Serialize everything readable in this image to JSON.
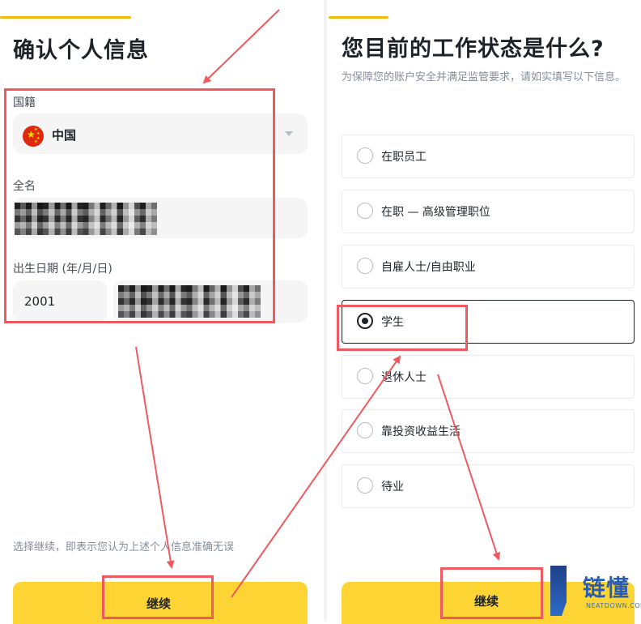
{
  "colors": {
    "accent": "#fcd535",
    "progress": "#f0b90b",
    "highlight": "#ef5a61",
    "text": "#1e2329",
    "muted": "#848e9c"
  },
  "left": {
    "title": "确认个人信息",
    "nationality_label": "国籍",
    "nationality_value": "中国",
    "fullname_label": "全名",
    "dob_label": "出生日期 (年/月/日)",
    "dob_year": "2001",
    "footnote": "选择继续，即表示您认为上述个人信息准确无误",
    "continue_label": "继续"
  },
  "right": {
    "title": "您目前的工作状态是什么?",
    "subtitle": "为保障您的账户安全并满足监管要求，请如实填写以下信息。",
    "options": [
      "在职员工",
      "在职 — 高级管理职位",
      "自雇人士/自由职业",
      "学生",
      "退休人士",
      "靠投资收益生活",
      "待业"
    ],
    "selected": "学生",
    "continue_label": "继续"
  },
  "watermark": {
    "name": "链懂",
    "domain": "NEATDOWN.COM"
  }
}
